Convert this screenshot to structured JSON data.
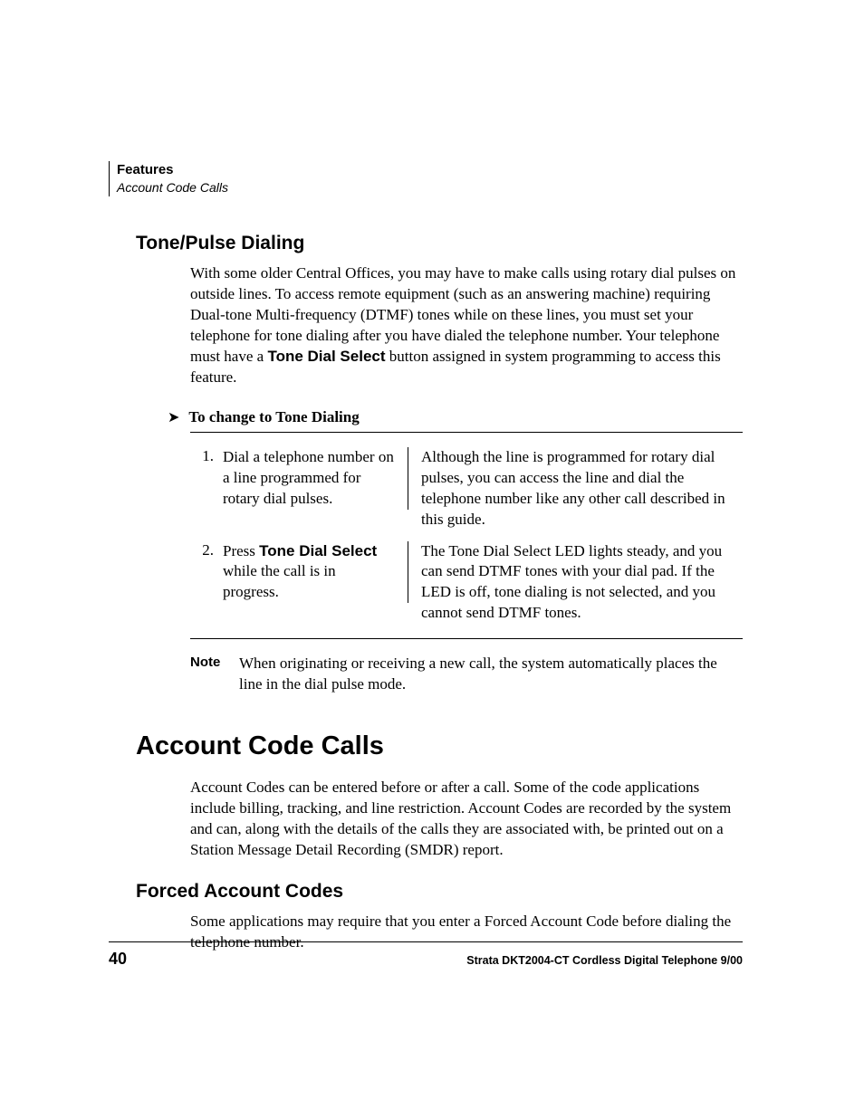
{
  "runningHead": {
    "bold": "Features",
    "italic": "Account Code Calls"
  },
  "section1": {
    "heading": "Tone/Pulse Dialing",
    "para_a": "With some older Central Offices, you may have to make calls using rotary dial pulses on outside lines. To access remote equipment (such as an answering machine) requiring Dual-tone Multi-frequency (DTMF) tones while on these lines, you must set your telephone for tone dialing after you have dialed the telephone number. Your telephone must have a ",
    "para_button": "Tone Dial Select",
    "para_b": " button assigned in system programming to access this feature.",
    "procTitle": "To change to Tone Dialing",
    "steps": [
      {
        "num": "1.",
        "left": "Dial a telephone number on a line programmed for rotary dial pulses.",
        "right": "Although the line is programmed for rotary dial pulses, you can access the line and dial the telephone number like any other call described in this guide."
      },
      {
        "num": "2.",
        "left_a": "Press ",
        "left_button": "Tone Dial Select",
        "left_b": " while the call is in progress.",
        "right": "The Tone Dial Select LED lights steady, and you can send DTMF tones with your dial pad. If the LED is off, tone dialing is not selected, and you cannot send DTMF tones."
      }
    ],
    "noteLabel": "Note",
    "noteBody": "When originating or receiving a new call, the system automatically places the line in the dial pulse mode."
  },
  "section2": {
    "heading": "Account Code Calls",
    "para": "Account Codes can be entered before or after a call. Some of the code applications include billing, tracking, and line restriction. Account Codes are recorded by the system and can, along with the details of the calls they are associated with, be printed out on a Station Message Detail Recording (SMDR) report."
  },
  "section3": {
    "heading": "Forced Account Codes",
    "para": "Some applications may require that you enter a Forced Account Code before dialing the telephone number."
  },
  "footer": {
    "pageNum": "40",
    "title": "Strata DKT2004-CT Cordless Digital Telephone   9/00"
  }
}
